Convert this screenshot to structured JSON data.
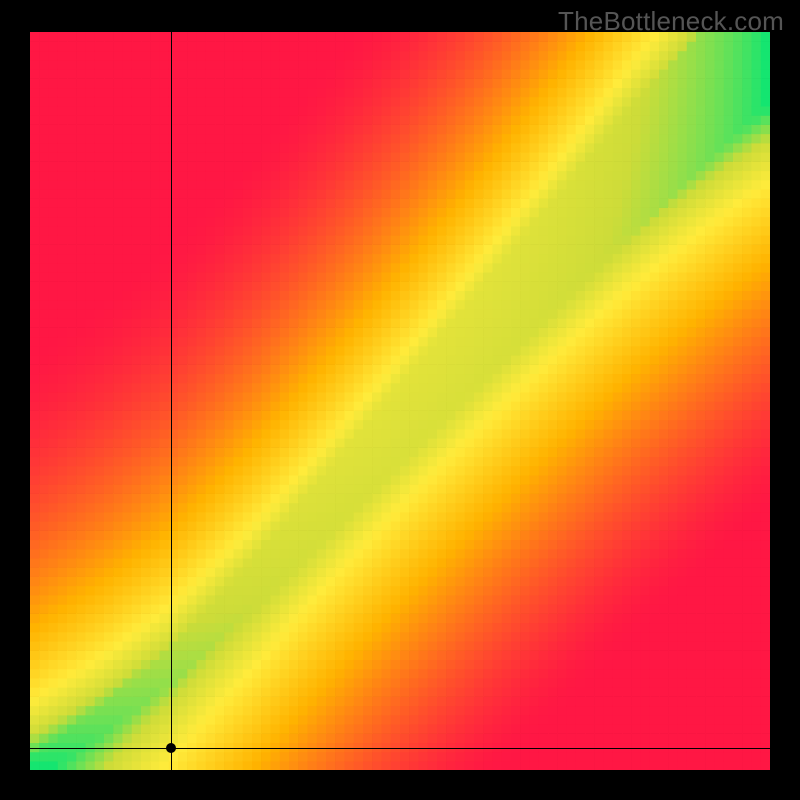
{
  "watermark": "TheBottleneck.com",
  "chart_data": {
    "type": "heatmap",
    "title": "",
    "xlabel": "",
    "ylabel": "",
    "xlim": [
      0,
      100
    ],
    "ylim": [
      0,
      100
    ],
    "marker": {
      "x": 19,
      "y": 3
    },
    "crosshair": {
      "x": 19,
      "y": 3
    },
    "colorscale": [
      {
        "t": 0.0,
        "hex": "#ff1744"
      },
      {
        "t": 0.45,
        "hex": "#ffb300"
      },
      {
        "t": 0.7,
        "hex": "#ffeb3b"
      },
      {
        "t": 0.85,
        "hex": "#cddc39"
      },
      {
        "t": 1.0,
        "hex": "#00e676"
      }
    ],
    "optimal_band": {
      "description": "green band where GPU and CPU are balanced; slight kink below ~20%",
      "control_points": [
        {
          "x": 0,
          "center_y": 0,
          "half_width": 1.5
        },
        {
          "x": 10,
          "center_y": 7,
          "half_width": 2.0
        },
        {
          "x": 20,
          "center_y": 15,
          "half_width": 2.5
        },
        {
          "x": 30,
          "center_y": 25,
          "half_width": 3.5
        },
        {
          "x": 40,
          "center_y": 36,
          "half_width": 4.5
        },
        {
          "x": 50,
          "center_y": 47,
          "half_width": 5.5
        },
        {
          "x": 60,
          "center_y": 58,
          "half_width": 6.5
        },
        {
          "x": 70,
          "center_y": 69,
          "half_width": 7.5
        },
        {
          "x": 80,
          "center_y": 80,
          "half_width": 8.5
        },
        {
          "x": 90,
          "center_y": 90,
          "half_width": 9.0
        },
        {
          "x": 100,
          "center_y": 100,
          "half_width": 9.5
        }
      ]
    },
    "pixelation": 80
  }
}
